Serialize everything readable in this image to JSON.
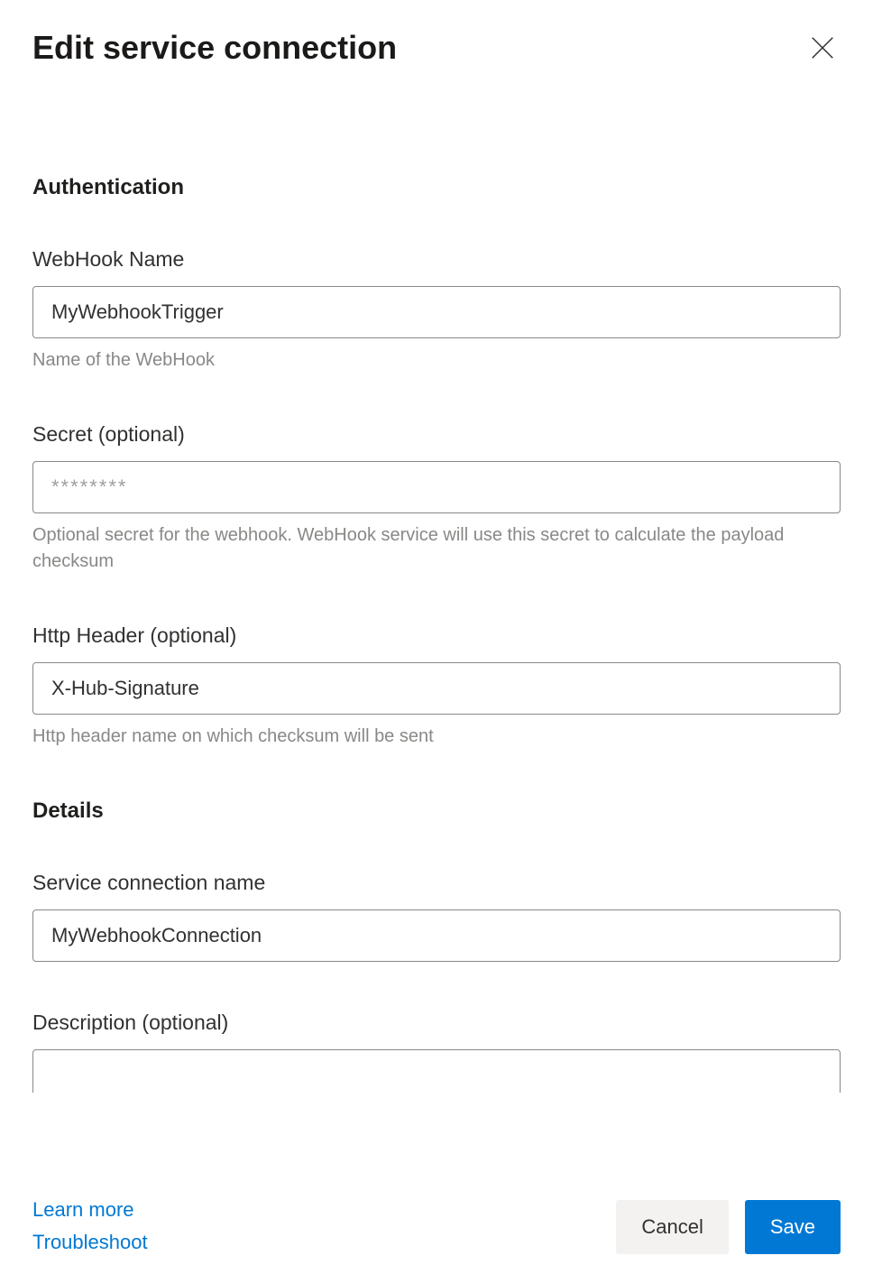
{
  "dialog": {
    "title": "Edit service connection"
  },
  "sections": {
    "authentication": {
      "heading": "Authentication",
      "webhook_name": {
        "label": "WebHook Name",
        "value": "MyWebhookTrigger",
        "help": "Name of the WebHook"
      },
      "secret": {
        "label": "Secret (optional)",
        "placeholder": "********",
        "value": "",
        "help": "Optional secret for the webhook. WebHook service will use this secret to calculate the payload checksum"
      },
      "http_header": {
        "label": "Http Header (optional)",
        "value": "X-Hub-Signature",
        "help": "Http header name on which checksum will be sent"
      }
    },
    "details": {
      "heading": "Details",
      "service_connection_name": {
        "label": "Service connection name",
        "value": "MyWebhookConnection"
      },
      "description": {
        "label": "Description (optional)",
        "value": ""
      }
    }
  },
  "footer": {
    "learn_more": "Learn more",
    "troubleshoot": "Troubleshoot",
    "cancel": "Cancel",
    "save": "Save"
  }
}
